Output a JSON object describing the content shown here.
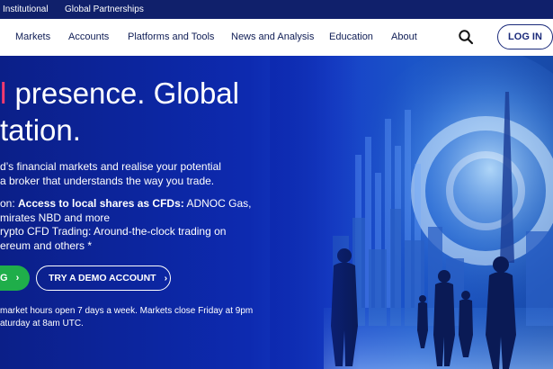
{
  "topbar": {
    "links": [
      "Institutional",
      "Global Partnerships"
    ]
  },
  "nav": {
    "items": [
      "Markets",
      "Accounts",
      "Platforms and Tools",
      "News and Analysis",
      "Education",
      "About"
    ],
    "search_icon": "search-icon",
    "login_label": "LOG IN"
  },
  "hero": {
    "headline_accent": "l",
    "headline_line1": " presence. Global",
    "headline_line2": "tation.",
    "intro_line1": "d’s financial markets and realise your potential",
    "intro_line2": "a broker that understands the way you trade.",
    "promo1_prefix": "on: ",
    "promo1_bold": "Access to local shares as CFDs:",
    "promo1_rest": " ADNOC Gas,",
    "promo1_line2": "mirates NBD and more",
    "promo2_line1": "rypto CFD Trading: Around-the-clock trading on",
    "promo2_line2": "ereum and others *",
    "green_button_label": "G",
    "demo_button_label": "TRY A DEMO ACCOUNT",
    "note_line1": "market hours open 7 days a week. Markets close Friday at 9pm",
    "note_line2": "aturday at 8am UTC."
  },
  "colors": {
    "accent": "#ff3a6e",
    "brand_navy": "#10206b",
    "cta_green": "#1fae4a"
  }
}
